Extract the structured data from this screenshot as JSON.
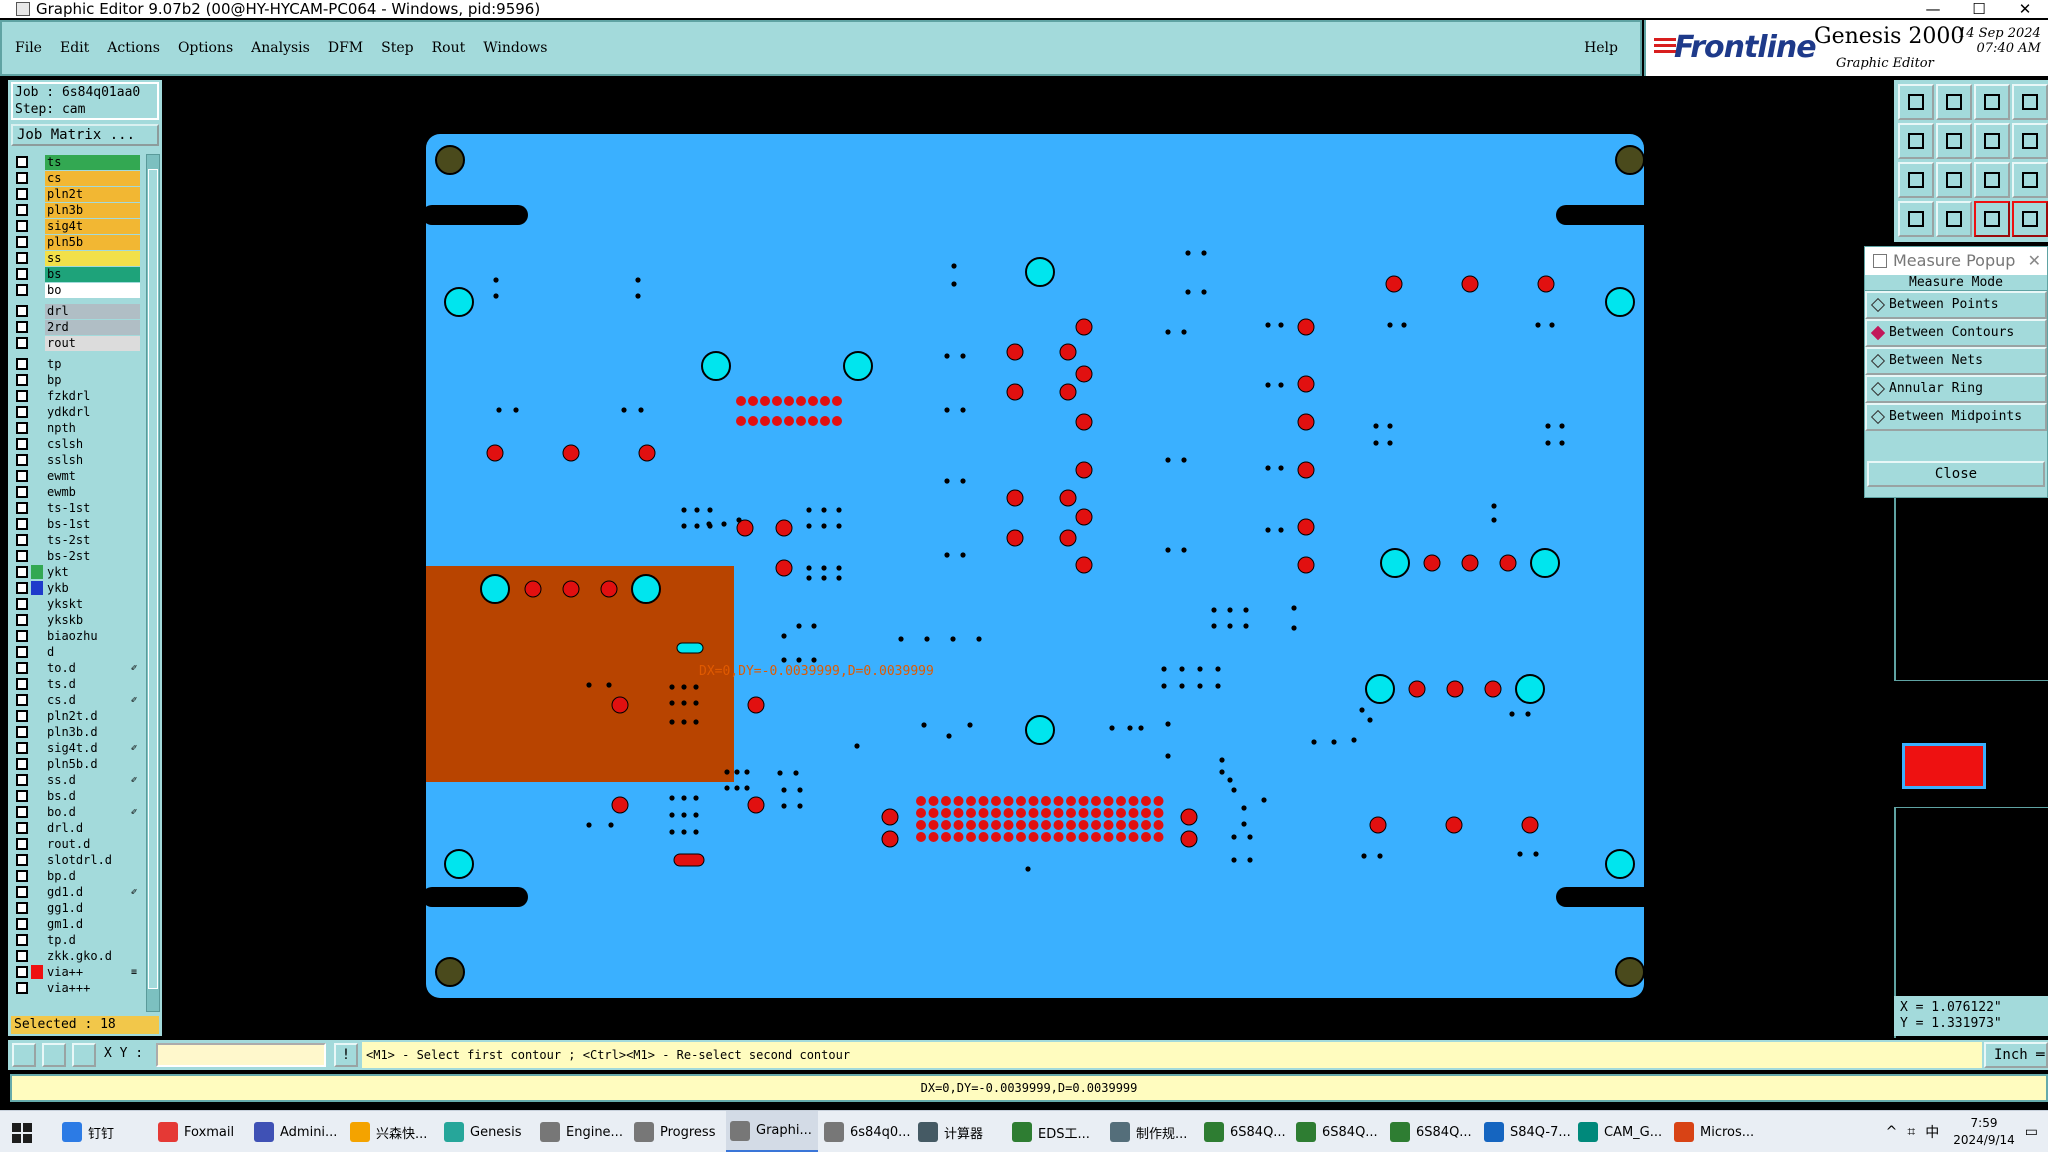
{
  "window": {
    "title": "Graphic Editor 9.07b2 (00@HY-HYCAM-PC064 - Windows, pid:9596)",
    "minimize": "—",
    "maximize": "☐",
    "close": "✕"
  },
  "menu": {
    "items": [
      "File",
      "Edit",
      "Actions",
      "Options",
      "Analysis",
      "DFM",
      "Step",
      "Rout",
      "Windows"
    ],
    "help": "Help"
  },
  "brand": {
    "logo": "Frontline",
    "product": "Genesis 2000",
    "subtitle": "Graphic Editor",
    "date": "14 Sep 2024",
    "time": "07:40 AM"
  },
  "job": {
    "job_line": "Job : 6s84q01aa0",
    "step_line": "Step: cam",
    "matrix_button": "Job Matrix ..."
  },
  "layers": [
    {
      "name": "ts",
      "color": "#33a852"
    },
    {
      "name": "cs",
      "color": "#f2b733"
    },
    {
      "name": "pln2t",
      "color": "#f2b733"
    },
    {
      "name": "pln3b",
      "color": "#f2b733"
    },
    {
      "name": "sig4t",
      "color": "#f2b733"
    },
    {
      "name": "pln5b",
      "color": "#f2b733"
    },
    {
      "name": "ss",
      "color": "#f2e04a"
    },
    {
      "name": "bs",
      "color": "#1ea37a"
    },
    {
      "name": "bo",
      "color": "#ffffff"
    },
    {
      "name": "drl",
      "color": "#b0bec5",
      "gap": true
    },
    {
      "name": "2rd",
      "color": "#b0bec5"
    },
    {
      "name": "rout",
      "color": "#dcdcdc"
    },
    {
      "name": "tp",
      "color": "#a3dadb",
      "gap": true
    },
    {
      "name": "bp",
      "color": "#a3dadb"
    },
    {
      "name": "fzkdrl",
      "color": "#a3dadb"
    },
    {
      "name": "ydkdrl",
      "color": "#a3dadb"
    },
    {
      "name": "npth",
      "color": "#a3dadb"
    },
    {
      "name": "cslsh",
      "color": "#a3dadb"
    },
    {
      "name": "sslsh",
      "color": "#a3dadb"
    },
    {
      "name": "ewmt",
      "color": "#a3dadb"
    },
    {
      "name": "ewmb",
      "color": "#a3dadb"
    },
    {
      "name": "ts-1st",
      "color": "#a3dadb"
    },
    {
      "name": "bs-1st",
      "color": "#a3dadb"
    },
    {
      "name": "ts-2st",
      "color": "#a3dadb"
    },
    {
      "name": "bs-2st",
      "color": "#a3dadb"
    },
    {
      "name": "ykt",
      "color": "#a3dadb",
      "mark": "#33a852"
    },
    {
      "name": "ykb",
      "color": "#a3dadb",
      "mark": "#1e3acb"
    },
    {
      "name": "ykskt",
      "color": "#a3dadb"
    },
    {
      "name": "ykskb",
      "color": "#a3dadb"
    },
    {
      "name": "biaozhu",
      "color": "#a3dadb"
    },
    {
      "name": "d",
      "color": "#a3dadb"
    },
    {
      "name": "to.d",
      "color": "#a3dadb",
      "flag": "✐"
    },
    {
      "name": "ts.d",
      "color": "#a3dadb"
    },
    {
      "name": "cs.d",
      "color": "#a3dadb",
      "flag": "✐"
    },
    {
      "name": "pln2t.d",
      "color": "#a3dadb"
    },
    {
      "name": "pln3b.d",
      "color": "#a3dadb"
    },
    {
      "name": "sig4t.d",
      "color": "#a3dadb",
      "flag": "✐"
    },
    {
      "name": "pln5b.d",
      "color": "#a3dadb"
    },
    {
      "name": "ss.d",
      "color": "#a3dadb",
      "flag": "✐"
    },
    {
      "name": "bs.d",
      "color": "#a3dadb"
    },
    {
      "name": "bo.d",
      "color": "#a3dadb",
      "flag": "✐"
    },
    {
      "name": "drl.d",
      "color": "#a3dadb"
    },
    {
      "name": "rout.d",
      "color": "#a3dadb"
    },
    {
      "name": "slotdrl.d",
      "color": "#a3dadb"
    },
    {
      "name": "bp.d",
      "color": "#a3dadb"
    },
    {
      "name": "gd1.d",
      "color": "#a3dadb",
      "flag": "✐"
    },
    {
      "name": "gg1.d",
      "color": "#a3dadb"
    },
    {
      "name": "gm1.d",
      "color": "#a3dadb"
    },
    {
      "name": "tp.d",
      "color": "#a3dadb"
    },
    {
      "name": "zkk.gko.d",
      "color": "#a3dadb"
    },
    {
      "name": "via++",
      "color": "#a3dadb",
      "mark": "#e11",
      "flag": "≡"
    },
    {
      "name": "via+++",
      "color": "#a3dadb"
    }
  ],
  "selected_label": "Selected : 18",
  "measure": {
    "title": "Measure Popup",
    "mode_label": "Measure Mode",
    "options": [
      {
        "label": "Between Points",
        "active": false
      },
      {
        "label": "Between Contours",
        "active": true
      },
      {
        "label": "Between Nets",
        "active": false
      },
      {
        "label": "Annular Ring",
        "active": false
      },
      {
        "label": "Between Midpoints",
        "active": false
      }
    ],
    "close_label": "Close"
  },
  "coords": {
    "x": "X = 1.076122\"",
    "y": "Y = 1.331973\""
  },
  "canvas_measure_label": "DX=0,DY=-0.0039999,D=0.0039999",
  "command": {
    "xy_label": "X Y :",
    "input_value": "",
    "prompt": "<M1> - Select first contour ; <Ctrl><M1> - Re-select second contour",
    "unit": "Inch ═"
  },
  "status_text": "DX=0,DY=-0.0039999,D=0.0039999",
  "colors": {
    "board": "#3ab0ff",
    "pad": "#e11010",
    "via": "#00e5ee",
    "highlight": "#b84400",
    "panel": "#a3dadb"
  },
  "taskbar": {
    "tasks": [
      {
        "label": "钉钉",
        "color": "#2c7be5"
      },
      {
        "label": "Foxmail",
        "color": "#e53935"
      },
      {
        "label": "Admini...",
        "color": "#3f51b5"
      },
      {
        "label": "兴森快...",
        "color": "#f4a300"
      },
      {
        "label": "Genesis",
        "color": "#26a69a"
      },
      {
        "label": "Engine...",
        "color": "#777"
      },
      {
        "label": "Progress",
        "color": "#777"
      },
      {
        "label": "Graphi...",
        "color": "#777",
        "active": true
      },
      {
        "label": "6s84q0...",
        "color": "#777"
      },
      {
        "label": "计算器",
        "color": "#455a64"
      },
      {
        "label": "EDS工...",
        "color": "#2e7d32"
      },
      {
        "label": "制作规...",
        "color": "#546e7a"
      },
      {
        "label": "6S84Q...",
        "color": "#2e7d32"
      },
      {
        "label": "6S84Q...",
        "color": "#2e7d32"
      },
      {
        "label": "6S84Q...",
        "color": "#2e7d32"
      },
      {
        "label": "S84Q-7...",
        "color": "#1565c0"
      },
      {
        "label": "CAM_G...",
        "color": "#00897b"
      },
      {
        "label": "Micros...",
        "color": "#d84315"
      }
    ],
    "tray_lang": "中",
    "time": "7:59",
    "date": "2024/9/14"
  }
}
